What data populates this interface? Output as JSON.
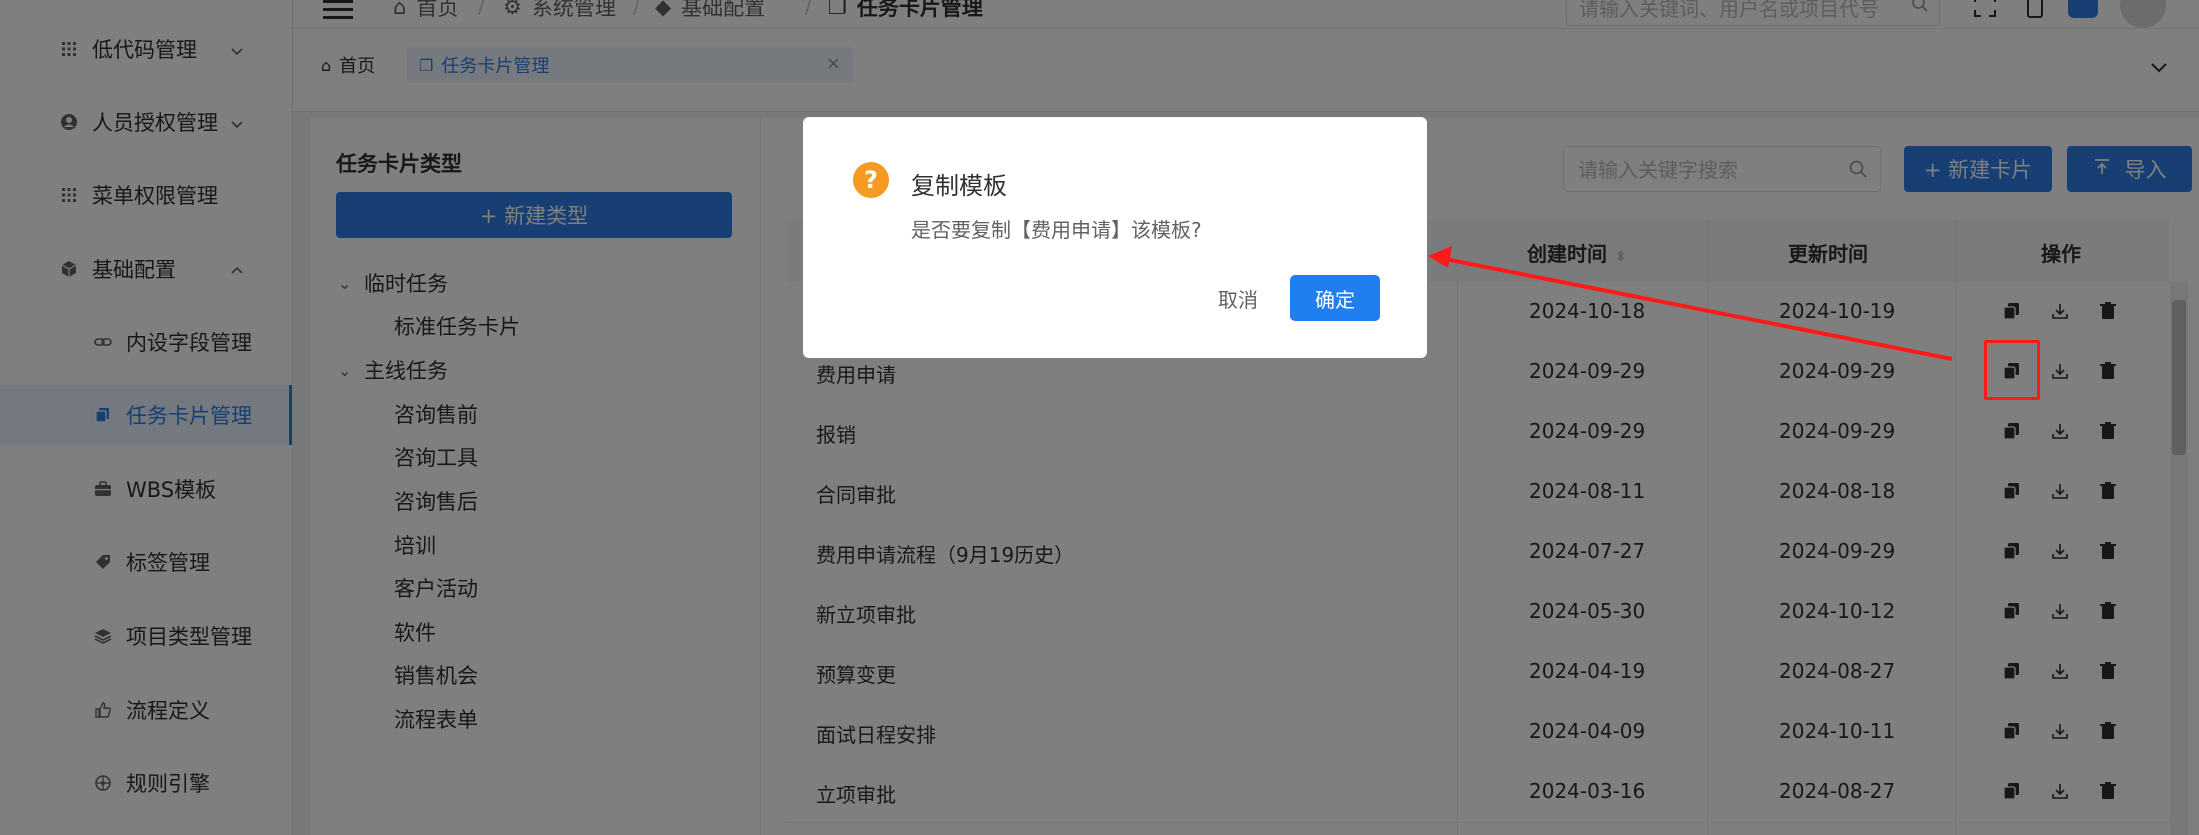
{
  "sidebar": {
    "items": [
      {
        "label": "低代码管理",
        "icon": "grid-icon"
      },
      {
        "label": "人员授权管理",
        "icon": "user-circle-icon"
      },
      {
        "label": "菜单权限管理",
        "icon": "grid-icon"
      },
      {
        "label": "基础配置",
        "icon": "cube-icon"
      }
    ],
    "subitems": [
      {
        "label": "内设字段管理",
        "icon": "link-icon"
      },
      {
        "label": "任务卡片管理",
        "icon": "copy-icon"
      },
      {
        "label": "WBS模板",
        "icon": "briefcase-icon"
      },
      {
        "label": "标签管理",
        "icon": "tag-icon"
      },
      {
        "label": "项目类型管理",
        "icon": "layers-icon"
      },
      {
        "label": "流程定义",
        "icon": "thumbs-up-icon"
      },
      {
        "label": "规则引擎",
        "icon": "wheel-icon"
      }
    ]
  },
  "header": {
    "breadcrumb": [
      "首页",
      "系统管理",
      "基础配置",
      "任务卡片管理"
    ],
    "global_search_placeholder": "请输入关键词、用户名或项目代号"
  },
  "tabs": [
    {
      "label": "首页"
    },
    {
      "label": "任务卡片管理"
    }
  ],
  "left_panel": {
    "title": "任务卡片类型",
    "new_type_button": "+ 新建类型",
    "tree": [
      {
        "label": "临时任务",
        "children": [
          "标准任务卡片"
        ]
      },
      {
        "label": "主线任务",
        "children": [
          "咨询售前",
          "咨询工具",
          "咨询售后",
          "培训",
          "客户活动",
          "软件",
          "销售机会",
          "流程表单"
        ]
      }
    ]
  },
  "right_panel": {
    "search_placeholder": "请输入关键字搜索",
    "new_card_button": "+ 新建卡片",
    "import_button": "导入",
    "columns": {
      "created": "创建时间",
      "updated": "更新时间",
      "actions": "操作"
    },
    "rows": [
      {
        "name": "",
        "created": "2024-10-18",
        "updated": "2024-10-19"
      },
      {
        "name": "费用申请",
        "created": "2024-09-29",
        "updated": "2024-09-29"
      },
      {
        "name": "报销",
        "created": "2024-09-29",
        "updated": "2024-09-29"
      },
      {
        "name": "合同审批",
        "created": "2024-08-11",
        "updated": "2024-08-18"
      },
      {
        "name": "费用申请流程（9月19历史）",
        "created": "2024-07-27",
        "updated": "2024-09-29"
      },
      {
        "name": "新立项审批",
        "created": "2024-05-30",
        "updated": "2024-10-12"
      },
      {
        "name": "预算变更",
        "created": "2024-04-19",
        "updated": "2024-08-27"
      },
      {
        "name": "面试日程安排",
        "created": "2024-04-09",
        "updated": "2024-10-11"
      },
      {
        "name": "立项审批",
        "created": "2024-03-16",
        "updated": "2024-08-27"
      }
    ]
  },
  "dialog": {
    "title": "复制模板",
    "message": "是否要复制【费用申请】该模板?",
    "cancel_label": "取消",
    "ok_label": "确定"
  },
  "colors": {
    "accent": "#2f7fe6",
    "warning": "#f59a23",
    "annotation": "#ff1a1a"
  }
}
